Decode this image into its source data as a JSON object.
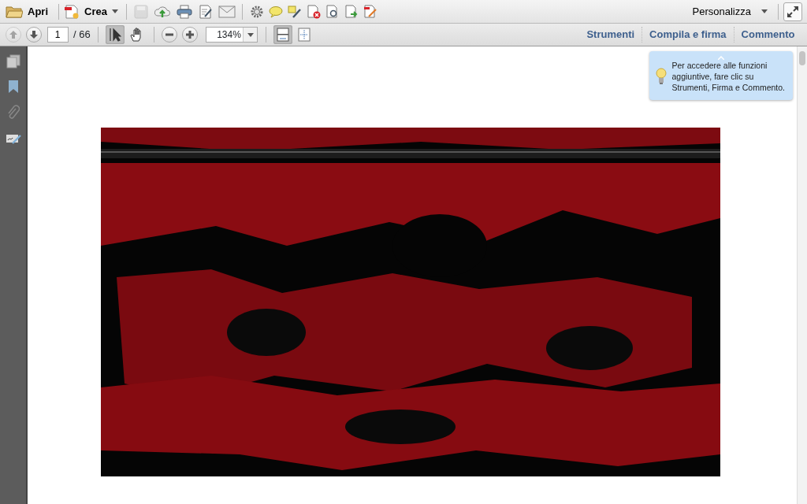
{
  "toolbar": {
    "open": "Apri",
    "create": "Crea",
    "save_disabled": true,
    "customize": "Personalizza"
  },
  "nav": {
    "prev_disabled": true,
    "next_disabled": false,
    "page": "1",
    "page_total": "/ 66",
    "select_selected": true,
    "hand_selected": false,
    "zoom": "134%",
    "fit_selected": true
  },
  "panels": [
    {
      "label": "Strumenti"
    },
    {
      "label": "Compila e firma"
    },
    {
      "label": "Commento"
    }
  ],
  "tip": {
    "text": "Per accedere alle funzioni aggiuntive, fare clic su Strumenti, Firma e Commento."
  }
}
